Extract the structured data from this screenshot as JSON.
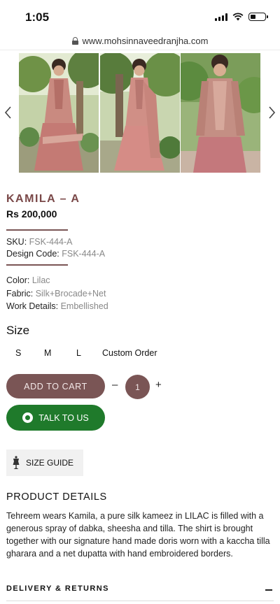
{
  "status": {
    "time": "1:05"
  },
  "browser": {
    "url": "www.mohsinnaveedranjha.com"
  },
  "product": {
    "title": "KAMILA – A",
    "price": "Rs 200,000",
    "sku_label": "SKU:",
    "sku_value": "FSK-444-A",
    "design_label": "Design Code:",
    "design_value": "FSK-444-A",
    "color_label": "Color:",
    "color_value": "Lilac",
    "fabric_label": "Fabric:",
    "fabric_value": "Silk+Brocade+Net",
    "work_label": "Work Details:",
    "work_value": "Embellished"
  },
  "size": {
    "heading": "Size",
    "options": [
      "S",
      "M",
      "L",
      "Custom Order"
    ]
  },
  "actions": {
    "add_to_cart": "ADD TO CART",
    "qty_minus": "–",
    "qty_value": "1",
    "qty_plus": "+",
    "talk_to_us": "TALK TO US",
    "size_guide": "SIZE GUIDE"
  },
  "details": {
    "heading": "PRODUCT DETAILS",
    "text": "Tehreem wears Kamila, a pure silk kameez in LILAC is filled with a generous spray of dabka, sheesha and tilla. The shirt is brought together with our signature hand made doris worn with a kaccha tilla gharara and a net dupatta with hand embroidered borders."
  },
  "delivery": {
    "label": "DELIVERY & RETURNS"
  },
  "icons": {
    "lock": "lock-icon",
    "gallery_prev": "chevron-left-icon",
    "gallery_next": "chevron-right-icon",
    "whatsapp": "whatsapp-icon",
    "size_guide": "dress-form-icon",
    "delivery_toggle": "minus-icon"
  },
  "colors": {
    "brand": "#7a5555",
    "title": "#7a4848",
    "whatsapp_green": "#1f7a2b"
  }
}
